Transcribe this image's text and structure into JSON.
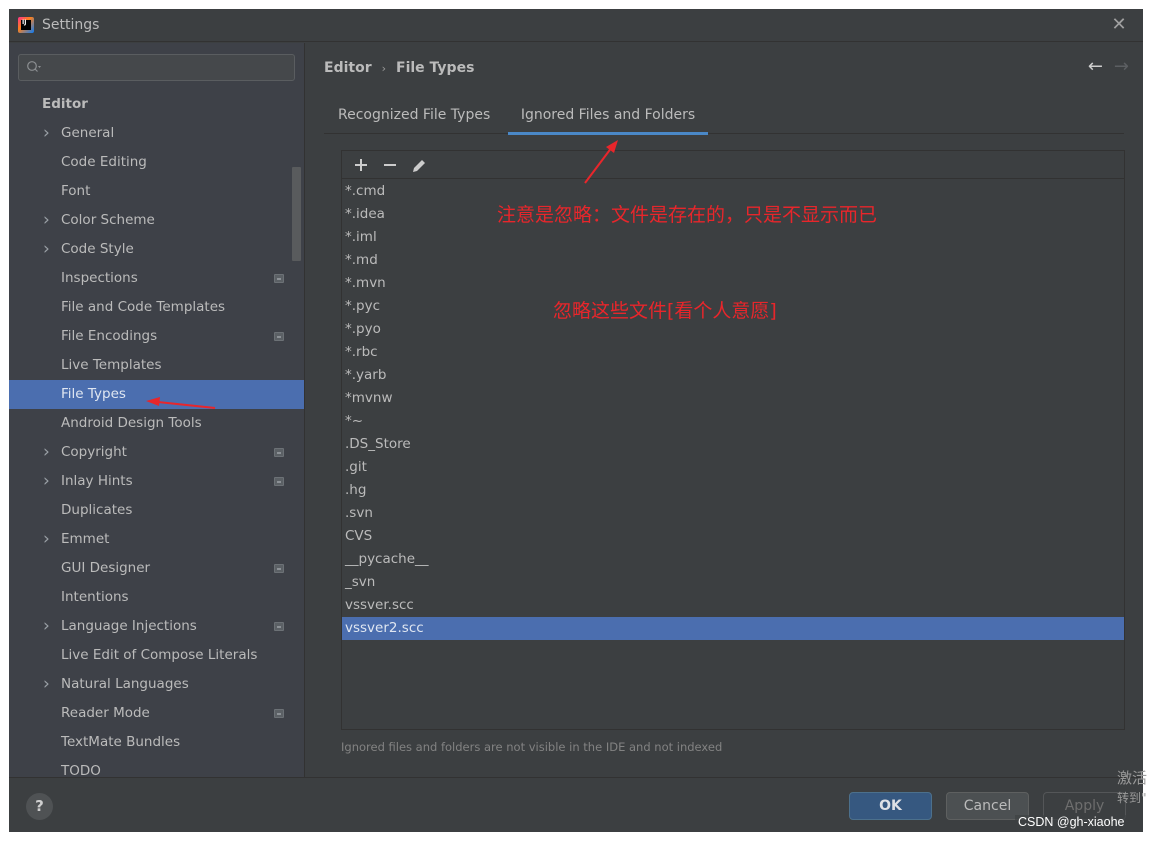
{
  "window": {
    "title": "Settings",
    "app_icon": "intellij-idea-icon",
    "close_icon": "close-icon"
  },
  "sidebar": {
    "search": {
      "value": "",
      "placeholder": ""
    },
    "items": [
      {
        "label": "Editor",
        "type": "group",
        "expandable": false,
        "project_icon": false
      },
      {
        "label": "General",
        "expandable": true,
        "project_icon": false
      },
      {
        "label": "Code Editing",
        "expandable": false,
        "project_icon": false
      },
      {
        "label": "Font",
        "expandable": false,
        "project_icon": false
      },
      {
        "label": "Color Scheme",
        "expandable": true,
        "project_icon": false
      },
      {
        "label": "Code Style",
        "expandable": true,
        "project_icon": false
      },
      {
        "label": "Inspections",
        "expandable": false,
        "project_icon": true
      },
      {
        "label": "File and Code Templates",
        "expandable": false,
        "project_icon": false
      },
      {
        "label": "File Encodings",
        "expandable": false,
        "project_icon": true
      },
      {
        "label": "Live Templates",
        "expandable": false,
        "project_icon": false
      },
      {
        "label": "File Types",
        "expandable": false,
        "project_icon": false,
        "selected": true
      },
      {
        "label": "Android Design Tools",
        "expandable": false,
        "project_icon": false
      },
      {
        "label": "Copyright",
        "expandable": true,
        "project_icon": true
      },
      {
        "label": "Inlay Hints",
        "expandable": true,
        "project_icon": true
      },
      {
        "label": "Duplicates",
        "expandable": false,
        "project_icon": false
      },
      {
        "label": "Emmet",
        "expandable": true,
        "project_icon": false
      },
      {
        "label": "GUI Designer",
        "expandable": false,
        "project_icon": true
      },
      {
        "label": "Intentions",
        "expandable": false,
        "project_icon": false
      },
      {
        "label": "Language Injections",
        "expandable": true,
        "project_icon": true
      },
      {
        "label": "Live Edit of Compose Literals",
        "expandable": false,
        "project_icon": false
      },
      {
        "label": "Natural Languages",
        "expandable": true,
        "project_icon": false
      },
      {
        "label": "Reader Mode",
        "expandable": false,
        "project_icon": true
      },
      {
        "label": "TextMate Bundles",
        "expandable": false,
        "project_icon": false
      },
      {
        "label": "TODO",
        "expandable": false,
        "project_icon": false
      }
    ]
  },
  "content": {
    "breadcrumb": {
      "parent": "Editor",
      "separator": "›",
      "current": "File Types"
    },
    "nav": {
      "back": "←",
      "forward": "→"
    },
    "tabs": [
      {
        "label": "Recognized File Types",
        "active": false
      },
      {
        "label": "Ignored Files and Folders",
        "active": true
      }
    ],
    "toolbar": {
      "add": "+",
      "remove": "−",
      "edit": "edit-icon"
    },
    "ignored_list": [
      "*.cmd",
      "*.idea",
      "*.iml",
      "*.md",
      "*.mvn",
      "*.pyc",
      "*.pyo",
      "*.rbc",
      "*.yarb",
      "*mvnw",
      "*~",
      ".DS_Store",
      ".git",
      ".hg",
      ".svn",
      "CVS",
      "__pycache__",
      "_svn",
      "vssver.scc",
      "vssver2.scc"
    ],
    "selected_index": 19,
    "hint": "Ignored files and folders are not visible in the IDE and not indexed"
  },
  "annotations": {
    "note_1": "注意是忽略：文件是存在的，只是不显示而已",
    "note_2": "忽略这些文件[看个人意愿]",
    "color": "#e8262b"
  },
  "footer": {
    "help": "?",
    "ok": "OK",
    "cancel": "Cancel",
    "apply": "Apply"
  },
  "overlay": {
    "activation_line1": "激活",
    "activation_line2": "转到\"",
    "watermark": "CSDN @gh-xiaohe"
  },
  "colors": {
    "window_bg": "#3c3f41",
    "sidebar_bg": "#3e4148",
    "selection": "#4b6eaf",
    "tab_underline": "#4a88c7",
    "ok_button": "#365880"
  }
}
